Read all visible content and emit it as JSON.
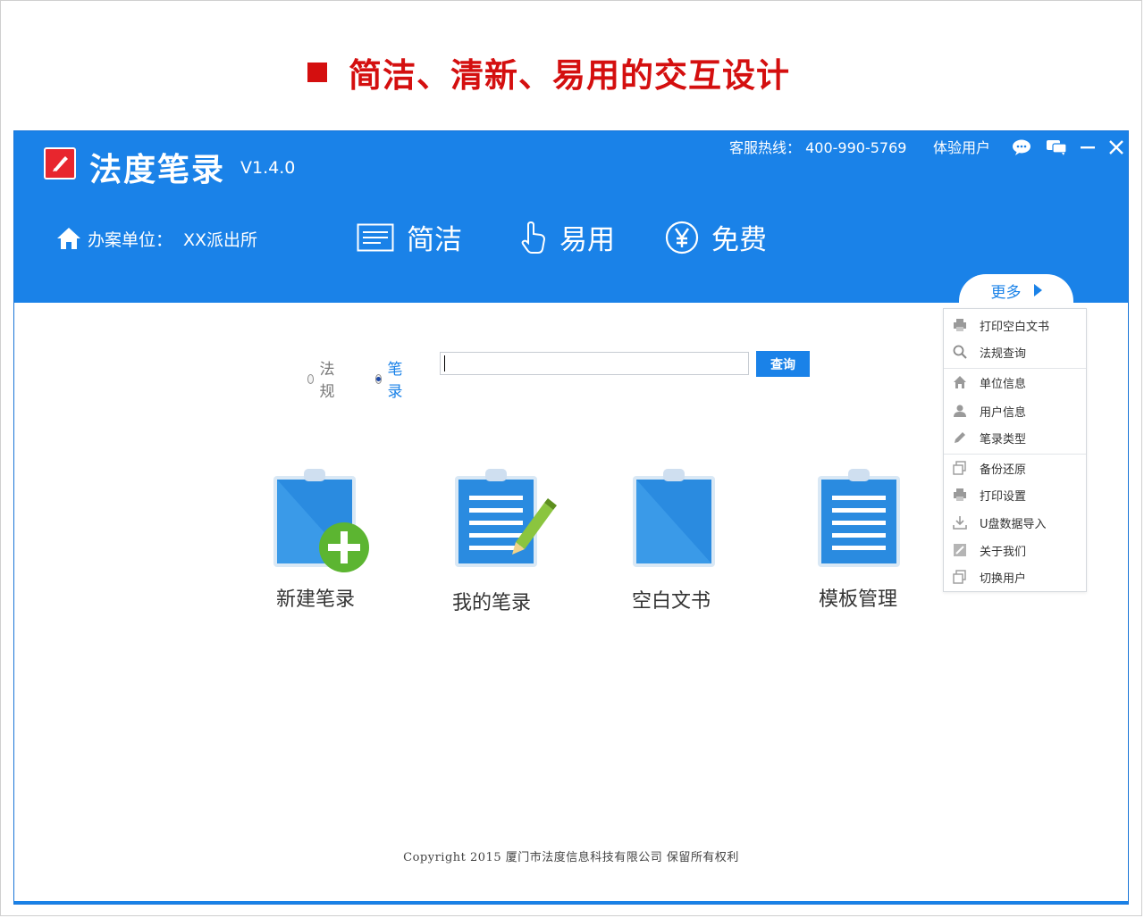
{
  "slide": {
    "title": "简洁、清新、易用的交互设计"
  },
  "app": {
    "name": "法度笔录",
    "version": "V1.4.0",
    "hotline": "客服热线： 400-990-5769",
    "user_type": "体验用户",
    "unit_label": "办案单位：",
    "unit_value": "XX派出所",
    "features": [
      {
        "label": "简洁",
        "icon": "document-lines-icon"
      },
      {
        "label": "易用",
        "icon": "pointing-hand-icon"
      },
      {
        "label": "免费",
        "icon": "yen-circle-icon"
      }
    ]
  },
  "more": {
    "label": "更多",
    "items": [
      {
        "label": "打印空白文书",
        "icon": "printer-icon"
      },
      {
        "label": "法规查询",
        "icon": "search-icon"
      },
      {
        "label": "单位信息",
        "icon": "home-icon"
      },
      {
        "label": "用户信息",
        "icon": "user-icon"
      },
      {
        "label": "笔录类型",
        "icon": "pencil-icon"
      },
      {
        "label": "备份还原",
        "icon": "backup-icon"
      },
      {
        "label": "打印设置",
        "icon": "printer-icon"
      },
      {
        "label": "U盘数据导入",
        "icon": "download-icon"
      },
      {
        "label": "关于我们",
        "icon": "info-icon"
      },
      {
        "label": "切换用户",
        "icon": "switch-icon"
      }
    ]
  },
  "search": {
    "options": [
      "法规",
      "笔录"
    ],
    "selected": "笔录",
    "value": "",
    "button": "查询"
  },
  "tiles": [
    {
      "label": "新建笔录",
      "icon": "new-note-icon"
    },
    {
      "label": "我的笔录",
      "icon": "my-notes-icon"
    },
    {
      "label": "空白文书",
      "icon": "blank-document-icon"
    },
    {
      "label": "模板管理",
      "icon": "template-icon"
    }
  ],
  "footer": {
    "copyright": "Copyright  2015  厦门市法度信息科技有限公司  保留所有权利"
  },
  "colors": {
    "accent": "#1a82e8",
    "title_red": "#d40f0f",
    "logo_red": "#e8262e",
    "plus_green": "#5cb531"
  }
}
